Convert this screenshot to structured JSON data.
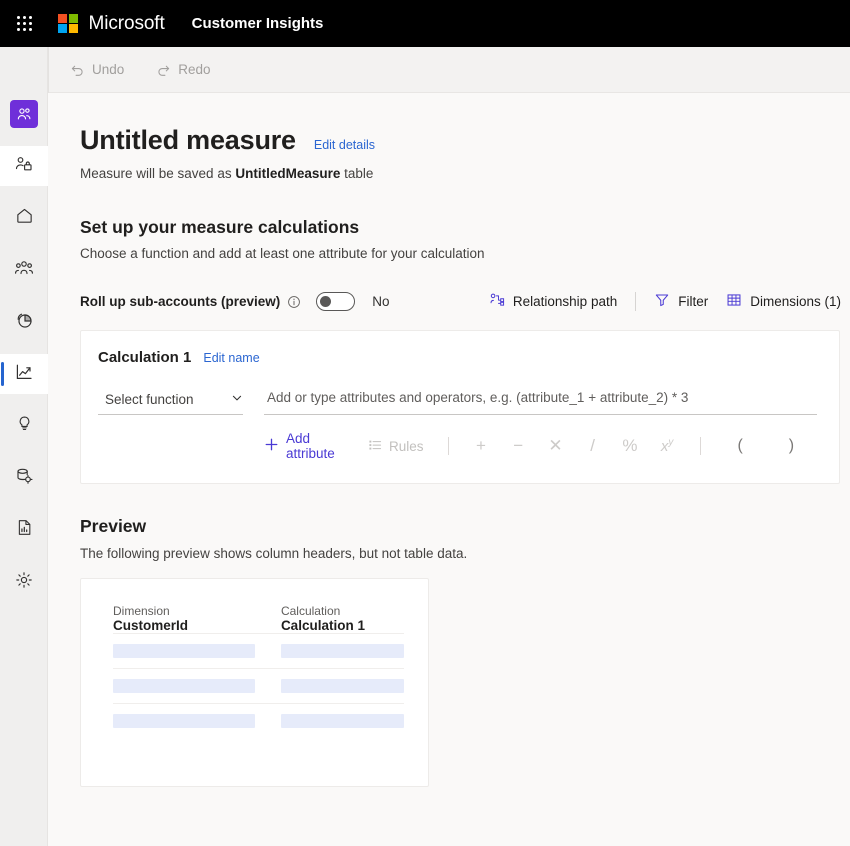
{
  "brandbar": {
    "waffle_icon": "app-launcher-icon",
    "logo_icon": "microsoft-logo-icon",
    "brand": "Microsoft",
    "app_name": "Customer Insights"
  },
  "commandbar": {
    "menu_icon": "hamburger-menu-icon",
    "undo_label": "Undo",
    "undo_icon": "undo-arrow-icon",
    "redo_label": "Redo",
    "redo_icon": "redo-arrow-icon"
  },
  "sidebar": {
    "items": [
      {
        "name": "profile-tile",
        "icon": "people-icon",
        "state": "tile-purple"
      },
      {
        "name": "admin-tile",
        "icon": "people-lock-icon",
        "state": "tile-white"
      },
      {
        "name": "home",
        "icon": "home-icon",
        "state": "normal"
      },
      {
        "name": "customers",
        "icon": "people-group-icon",
        "state": "normal"
      },
      {
        "name": "segments",
        "icon": "pie-chart-icon",
        "state": "normal"
      },
      {
        "name": "measures",
        "icon": "line-chart-icon",
        "state": "selected"
      },
      {
        "name": "intelligence",
        "icon": "lightbulb-icon",
        "state": "normal"
      },
      {
        "name": "data",
        "icon": "database-gear-icon",
        "state": "normal"
      },
      {
        "name": "reports",
        "icon": "report-document-icon",
        "state": "normal"
      },
      {
        "name": "settings",
        "icon": "gear-icon",
        "state": "normal"
      }
    ]
  },
  "page": {
    "title": "Untitled measure",
    "edit_details_label": "Edit details",
    "saved_as_prefix": "Measure will be saved as ",
    "saved_as_table": "UntitledMeasure",
    "saved_as_suffix": " table"
  },
  "setup": {
    "heading": "Set up your measure calculations",
    "subheading": "Choose a function and add at least one attribute for your calculation",
    "rollup_label": "Roll up sub-accounts (preview)",
    "rollup_info_icon": "info-circle-icon",
    "rollup_toggle_value": "No",
    "relationship_path_label": "Relationship path",
    "relationship_path_icon": "relationship-path-icon",
    "filter_label": "Filter",
    "filter_icon": "filter-funnel-icon",
    "dimensions_label": "Dimensions (1)",
    "dimensions_icon": "table-grid-icon"
  },
  "calculation": {
    "name": "Calculation 1",
    "edit_name_label": "Edit name",
    "function_select_value": "Select function",
    "function_chevron_icon": "chevron-down-icon",
    "expression_value": "",
    "expression_placeholder": "Add or type attributes and operators, e.g. (attribute_1 + attribute_2) * 3",
    "add_attribute_label": "Add attribute",
    "add_attribute_icon": "plus-icon",
    "rules_label": "Rules",
    "rules_icon": "rules-list-icon",
    "operators": [
      {
        "name": "plus-operator",
        "glyph": "+"
      },
      {
        "name": "minus-operator",
        "glyph": "−"
      },
      {
        "name": "multiply-operator",
        "glyph": "✕"
      },
      {
        "name": "divide-operator",
        "glyph": "/"
      },
      {
        "name": "percent-operator",
        "glyph": "%"
      }
    ],
    "power_operator": {
      "name": "power-operator",
      "base": "x",
      "exp": "y"
    },
    "parens": [
      {
        "name": "open-paren-operator",
        "glyph": "("
      },
      {
        "name": "close-paren-operator",
        "glyph": ")"
      }
    ]
  },
  "preview": {
    "heading": "Preview",
    "subheading": "The following preview shows column headers, but not table data.",
    "columns": [
      {
        "kind": "Dimension",
        "name": "CustomerId"
      },
      {
        "kind": "Calculation",
        "name": "Calculation 1"
      }
    ],
    "placeholder_row_count": 3
  },
  "colors": {
    "brand_purple": "#6f2fd9",
    "accent_blue": "#2b66d1",
    "link_indigo": "#4a3ad4",
    "selected_indicator": "#2564cf",
    "page_bg": "#faf9f8",
    "skeleton": "#e6ebfa",
    "logo_red": "#f25022",
    "logo_green": "#7fba00",
    "logo_blue": "#00a4ef",
    "logo_yellow": "#ffb900"
  }
}
